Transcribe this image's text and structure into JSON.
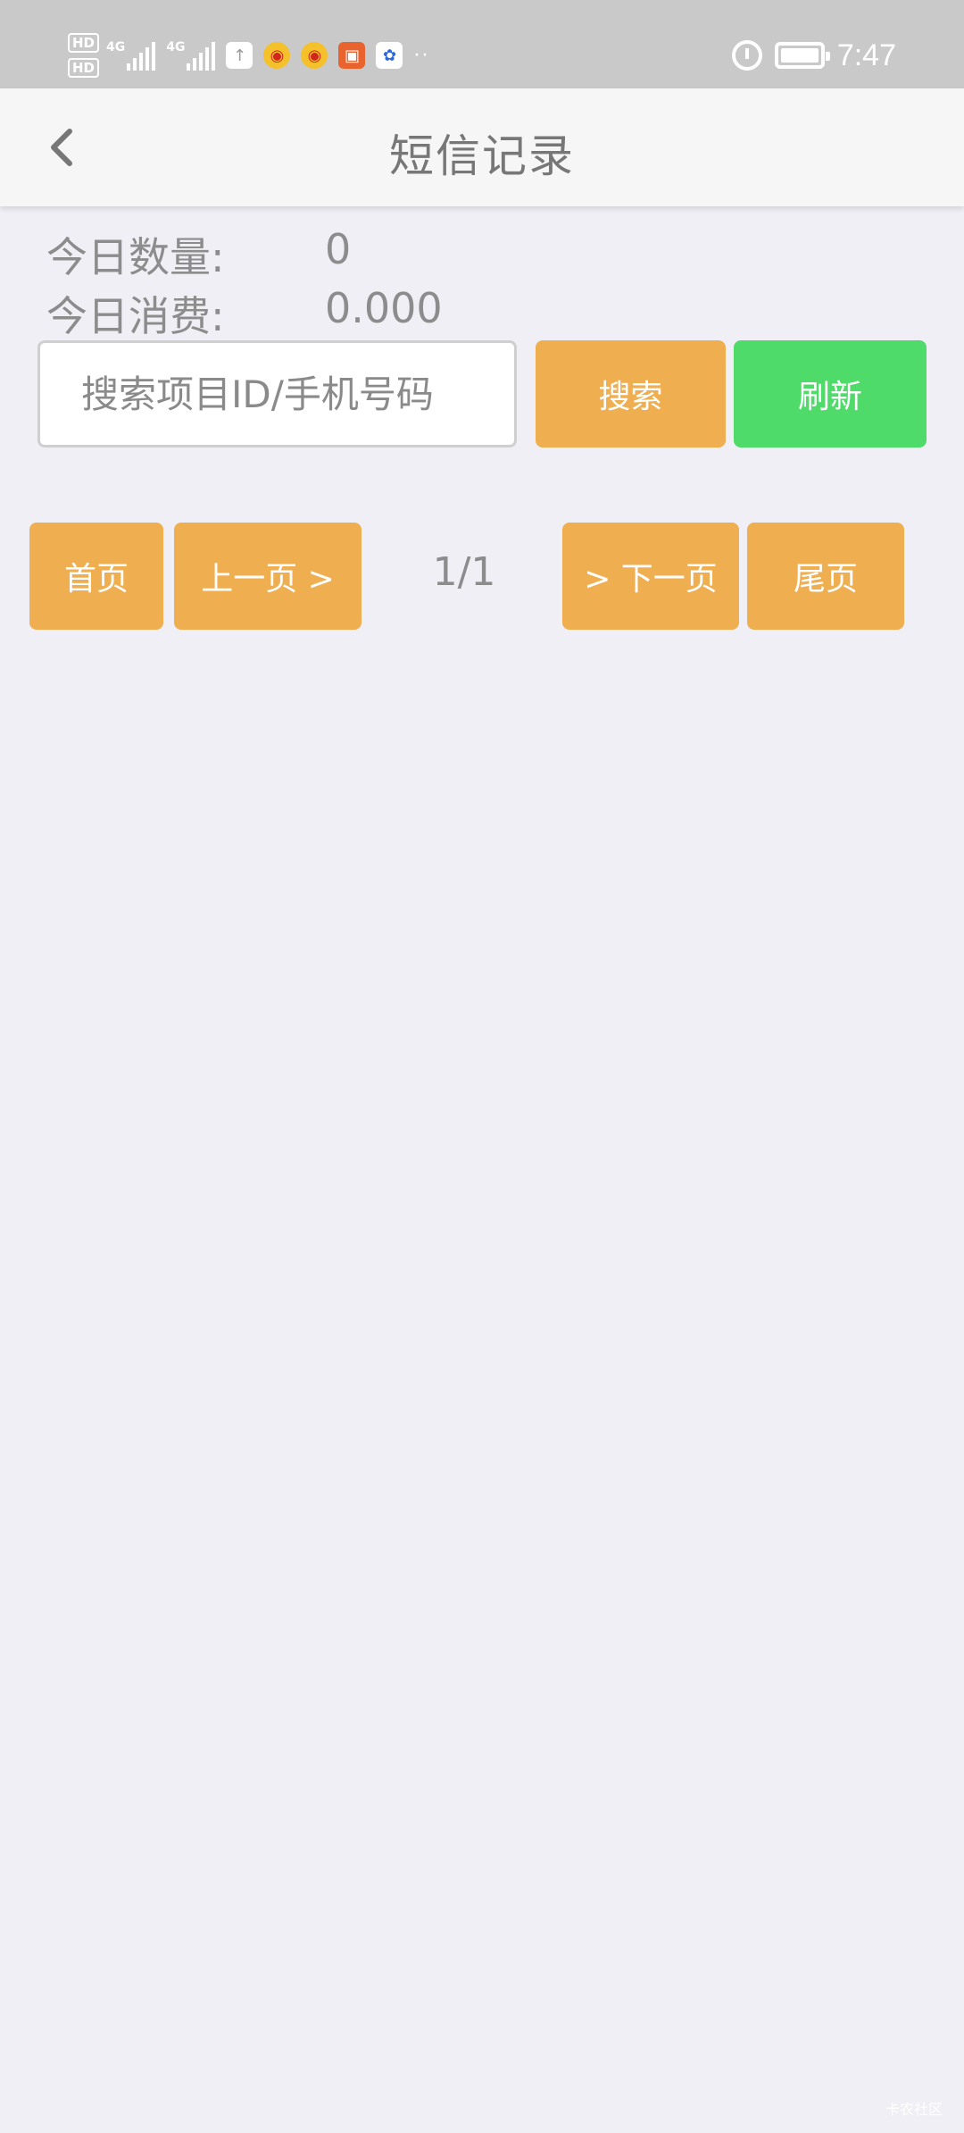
{
  "status_bar": {
    "sim1": "HD",
    "sim2": "HD",
    "net1": "4G",
    "net2": "4G",
    "more": "··",
    "time": "7:47",
    "icons": [
      "upload-icon",
      "weibo-icon",
      "weibo-icon",
      "red-app-icon",
      "baidu-icon",
      "alarm-icon",
      "battery-icon"
    ]
  },
  "header": {
    "title": "短信记录",
    "back_icon": "chevron-left-icon"
  },
  "stats": {
    "count_label": "今日数量:",
    "count_value": "0",
    "cost_label": "今日消费:",
    "cost_value": "0.000"
  },
  "search": {
    "placeholder": "搜索项目ID/手机号码",
    "search_label": "搜索",
    "refresh_label": "刷新"
  },
  "pagination": {
    "first_label": "首页",
    "prev_label": "上一页 >",
    "indicator": "1/1",
    "next_label": "> 下一页",
    "last_label": "尾页"
  },
  "colors": {
    "accent_orange": "#efae4f",
    "accent_green": "#4fdb6a",
    "background": "#efeff5",
    "header_bg": "#f6f6f6"
  },
  "watermark": "卡农社区"
}
